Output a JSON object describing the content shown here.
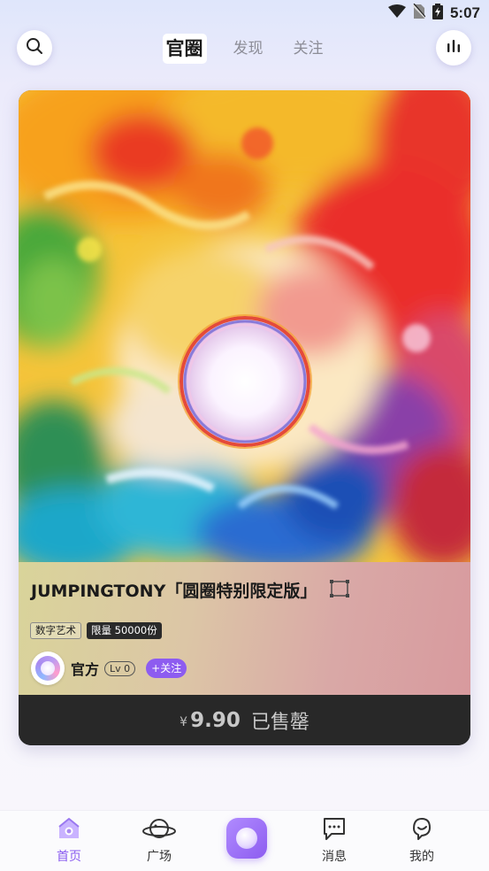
{
  "status_bar": {
    "time": "5:07",
    "icons": [
      "wifi-icon",
      "no-sim-icon",
      "battery-charging-icon"
    ]
  },
  "header": {
    "left_icon": "search-icon",
    "right_icon": "stats-icon",
    "tabs": [
      {
        "label": "官圈",
        "active": true
      },
      {
        "label": "发现",
        "active": false
      },
      {
        "label": "关注",
        "active": false
      }
    ]
  },
  "card": {
    "title": "JUMPINGTONY「圆圈特别限定版」",
    "title_icon": "fullscreen-frame-icon",
    "tags": [
      {
        "label": "数字艺术",
        "style": "outline"
      },
      {
        "label": "限量 50000份",
        "style": "dark"
      }
    ],
    "creator": {
      "name": "官方",
      "level": "Lv 0",
      "follow_label": "+关注"
    },
    "price": {
      "currency": "¥",
      "amount": "9.90",
      "status": "已售罄"
    }
  },
  "bottom_nav": {
    "items": [
      {
        "label": "首页",
        "icon": "home-icon",
        "active": true
      },
      {
        "label": "广场",
        "icon": "planet-icon",
        "active": false
      },
      {
        "label": "",
        "icon": "center-orb-icon",
        "active": false
      },
      {
        "label": "消息",
        "icon": "message-icon",
        "active": false
      },
      {
        "label": "我的",
        "icon": "profile-icon",
        "active": false
      }
    ]
  },
  "colors": {
    "accent": "#8d5cf0",
    "price_bar": "#282828",
    "active_tab_text": "#1b1b1b",
    "inactive_tab_text": "#8d8d97"
  }
}
